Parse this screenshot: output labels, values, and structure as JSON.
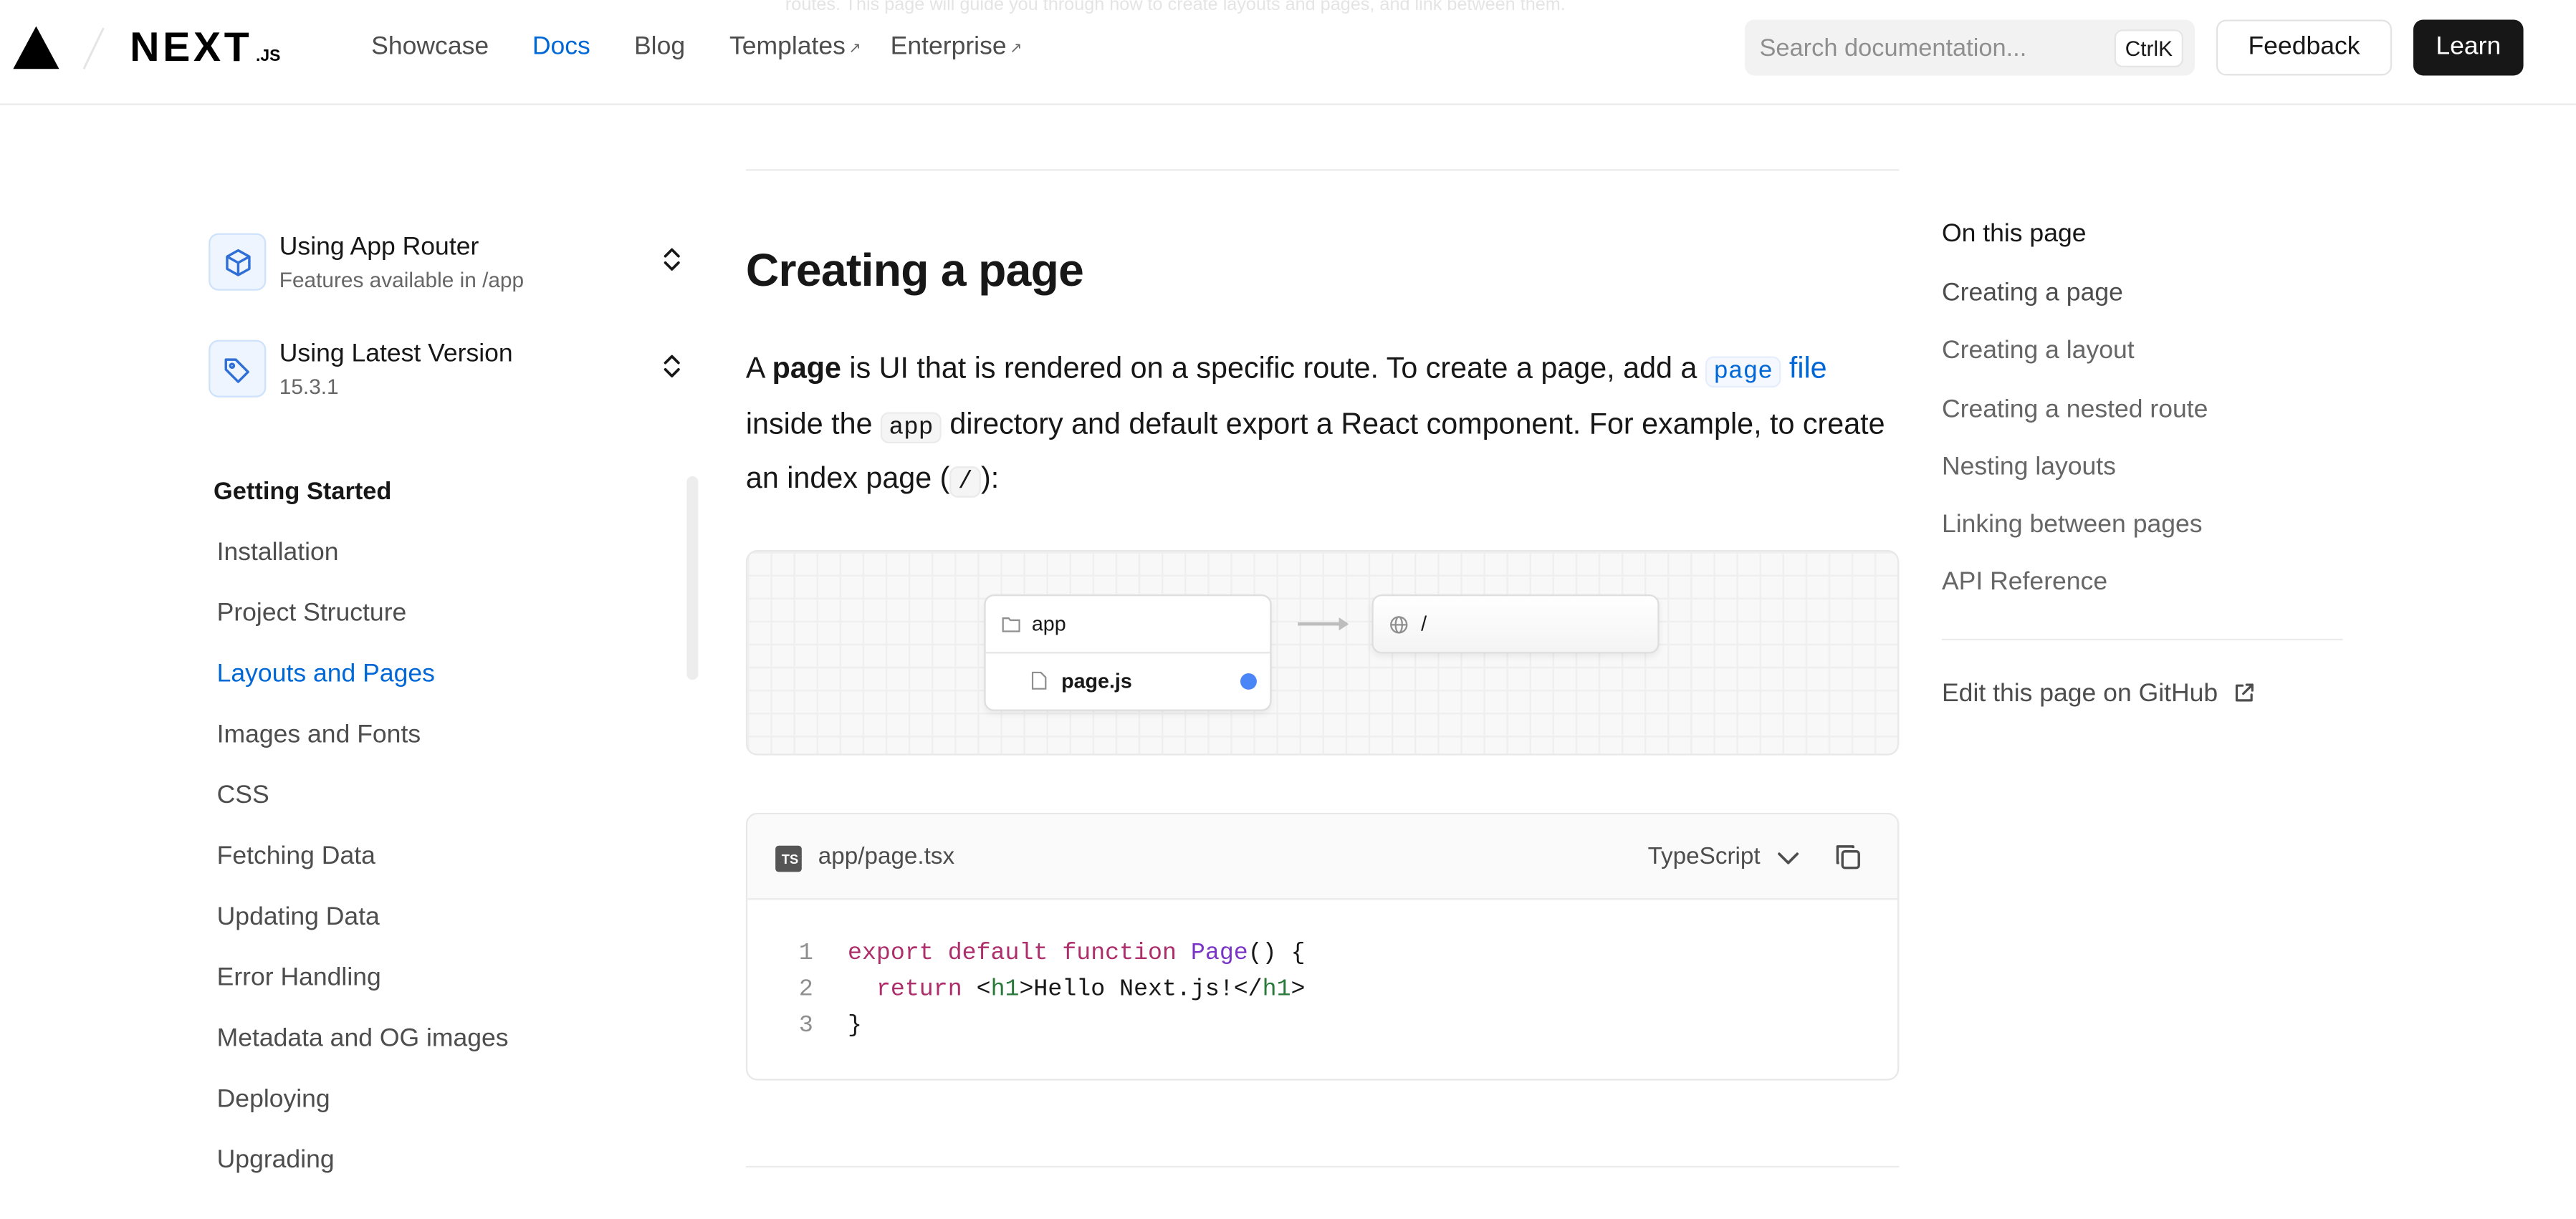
{
  "header": {
    "ghost_text": "routes. This page will guide you through how to create layouts and pages, and link between them.",
    "logo_word": "NEXT",
    "logo_suffix": ".JS",
    "nav": [
      {
        "label": "Showcase",
        "external": false,
        "active": false
      },
      {
        "label": "Docs",
        "external": false,
        "active": true
      },
      {
        "label": "Blog",
        "external": false,
        "active": false
      },
      {
        "label": "Templates",
        "external": true,
        "active": false
      },
      {
        "label": "Enterprise",
        "external": true,
        "active": false
      }
    ],
    "external_glyph": "↗",
    "search_placeholder": "Search documentation...",
    "search_shortcut": "CtrlK",
    "feedback_label": "Feedback",
    "learn_label": "Learn"
  },
  "sidebar": {
    "router_selector": {
      "title": "Using App Router",
      "subtitle": "Features available in /app",
      "icon": "cube-icon"
    },
    "version_selector": {
      "title": "Using Latest Version",
      "subtitle": "15.3.1",
      "icon": "tag-icon"
    },
    "section_heading": "Getting Started",
    "items": [
      {
        "label": "Installation",
        "active": false
      },
      {
        "label": "Project Structure",
        "active": false
      },
      {
        "label": "Layouts and Pages",
        "active": true
      },
      {
        "label": "Images and Fonts",
        "active": false
      },
      {
        "label": "CSS",
        "active": false
      },
      {
        "label": "Fetching Data",
        "active": false
      },
      {
        "label": "Updating Data",
        "active": false
      },
      {
        "label": "Error Handling",
        "active": false
      },
      {
        "label": "Metadata and OG images",
        "active": false
      },
      {
        "label": "Deploying",
        "active": false
      },
      {
        "label": "Upgrading",
        "active": false
      }
    ]
  },
  "main": {
    "heading": "Creating a page",
    "para": {
      "t1": "A ",
      "bold": "page",
      "t2": " is UI that is rendered on a specific route. To create a page, add a ",
      "code_page": "page",
      "link_file": "file",
      "t3": " inside the ",
      "code_app": "app",
      "t4": " directory and default export a React component. For example, to create an index page (",
      "code_slash": "/",
      "t5": "):"
    },
    "diagram": {
      "folder": "app",
      "file": "page.js",
      "route": "/"
    },
    "code": {
      "filename": "app/page.tsx",
      "language": "TypeScript",
      "lines": [
        {
          "n": "1"
        },
        {
          "n": "2"
        },
        {
          "n": "3"
        }
      ],
      "tokens": {
        "export": "export",
        "default": "default",
        "function": "function",
        "fn_name": "Page",
        "sig": "() {",
        "return_kw": "return",
        "open_lt": "<",
        "tag": "h1",
        "gt_text": ">Hello Next.js!</",
        "close_gt": ">",
        "brace": "}"
      }
    }
  },
  "toc": {
    "heading": "On this page",
    "items": [
      {
        "label": "Creating a page",
        "active": true
      },
      {
        "label": "Creating a layout",
        "active": false
      },
      {
        "label": "Creating a nested route",
        "active": false
      },
      {
        "label": "Nesting layouts",
        "active": false
      },
      {
        "label": "Linking between pages",
        "active": false
      },
      {
        "label": "API Reference",
        "active": false
      }
    ],
    "edit_label": "Edit this page on GitHub"
  },
  "colors": {
    "accent": "#0068d6",
    "text": "#171717",
    "muted": "#666666",
    "keyword": "#ad2e6b",
    "function": "#7a35c6",
    "tag": "#297a3a",
    "indicator": "#4a86f5"
  }
}
